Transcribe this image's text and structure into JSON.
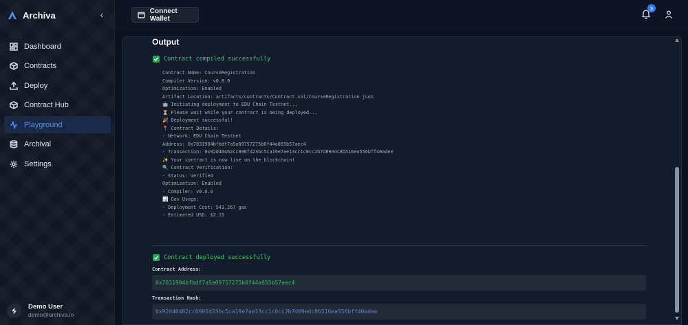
{
  "brand": {
    "name": "Archiva",
    "accent": "#4d8ef5"
  },
  "sidebar": {
    "collapse_icon": "chevron-left-icon",
    "items": [
      {
        "label": "Dashboard",
        "icon": "dashboard-icon",
        "active": false
      },
      {
        "label": "Contracts",
        "icon": "cube-icon",
        "active": false
      },
      {
        "label": "Deploy",
        "icon": "upload-icon",
        "active": false
      },
      {
        "label": "Contract Hub",
        "icon": "cube-icon",
        "active": false
      },
      {
        "label": "Playground",
        "icon": "activity-icon",
        "active": true
      },
      {
        "label": "Archival",
        "icon": "database-icon",
        "active": false
      },
      {
        "label": "Settings",
        "icon": "gear-icon",
        "active": false
      }
    ],
    "user": {
      "name": "Demo User",
      "email": "demo@archiva.io"
    }
  },
  "topbar": {
    "connect_label": "Connect Wallet",
    "notification_count": "3"
  },
  "output": {
    "title": "Output",
    "compiled_status": "Contract compiled successfully",
    "log_lines": [
      "Contract Name: CourseRegistration",
      "Compiler Version: v0.8.0",
      "Optimization: Enabled",
      "Artifact Location: artifacts/contracts/Contract.sol/CourseRegistration.json",
      "🤖 Initiating deployment to EDU Chain Testnet...",
      "⏳ Please wait while your contract is being deployed...",
      "🎉 Deployment successful!",
      "📍 Contract Details:",
      "- Network: EDU Chain Testnet",
      "  Address: 0x7831904bfbdf7a5a09757275b0f44a855b57aec4",
      "- Transaction: 0x92d40462cc890fd23bc5ca19e7ae13cc1c0cc2b7d09edc8b516ea556bff40adee",
      "✨ Your contract is now live on the blockchain!",
      "🔍 Contract Verification:",
      "- Status: Verified",
      "  Optimization: Enabled",
      "- Compiler: v0.8.0",
      "📊 Gas Usage:",
      "- Deployment Cost: 543,267 gas",
      "- Estimated USD: $2.15"
    ],
    "deployed_status": "Contract deployed successfully",
    "address_label": "Contract Address:",
    "address_value": "0x7831904bfbdf7a5a09757275b0f44a855b57aec4",
    "tx_label": "Transaction Hash:",
    "tx_value": "0x92d40462cc0901d23bc5ca19e7ae13cc1c0cc2b7d09edc8b516ea556bff40adee"
  },
  "colors": {
    "success": "#2bbf67",
    "panel": "#141b2b",
    "sidebar": "#111723"
  }
}
